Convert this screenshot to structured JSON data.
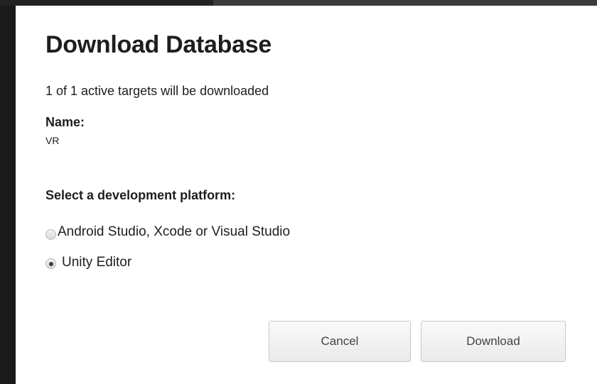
{
  "dialog": {
    "title": "Download Database",
    "summary": "1 of 1 active targets will be downloaded",
    "name_label": "Name:",
    "name_value": "VR",
    "platform_label": "Select a development platform:",
    "platform_options": [
      {
        "label": "Android Studio, Xcode or Visual Studio",
        "selected": false
      },
      {
        "label": "Unity Editor",
        "selected": true
      }
    ],
    "buttons": {
      "cancel": "Cancel",
      "download": "Download"
    }
  }
}
